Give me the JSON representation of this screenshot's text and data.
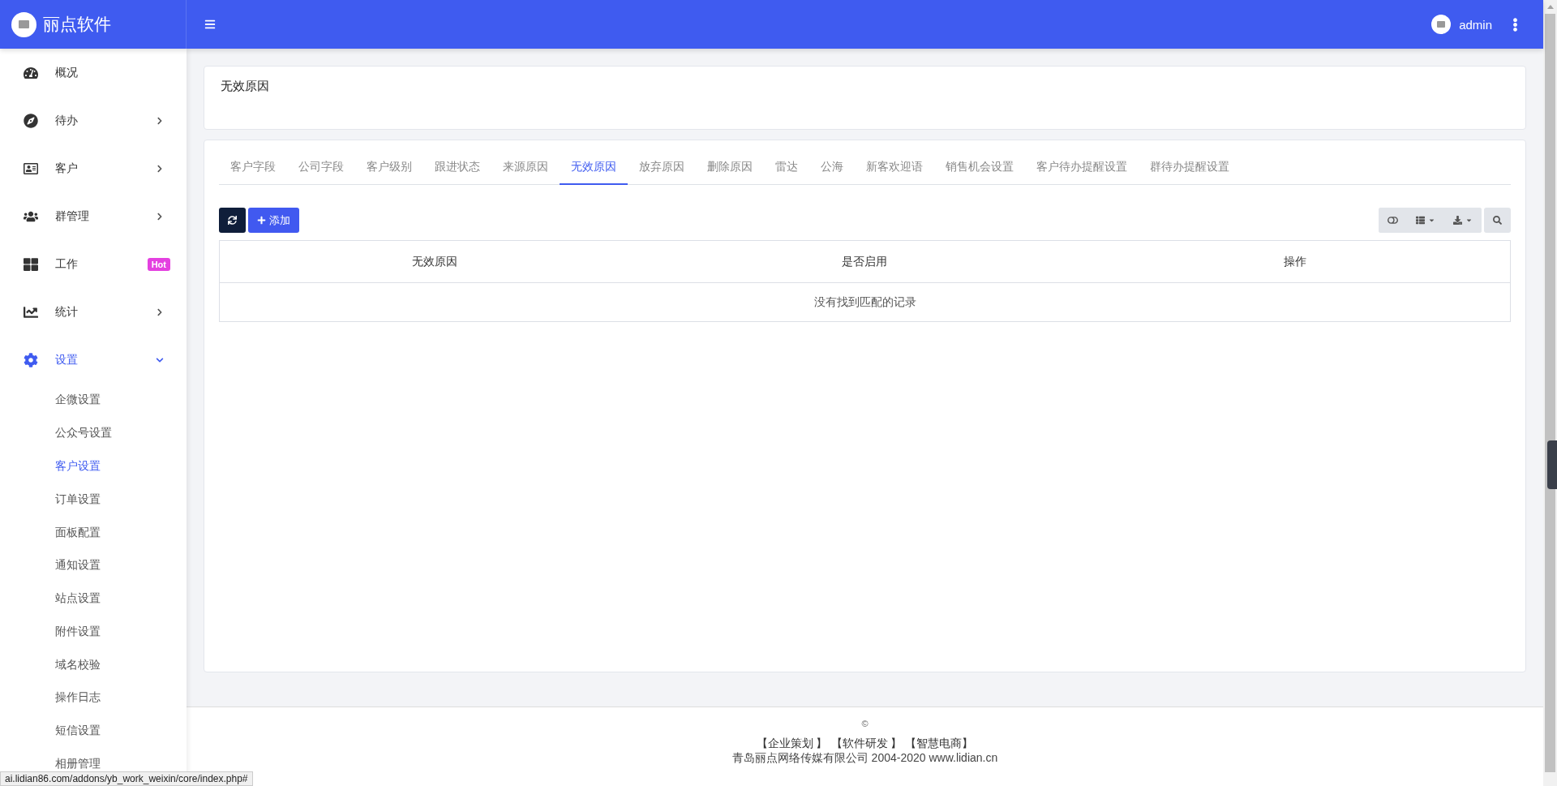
{
  "brand": {
    "name": "丽点软件"
  },
  "header": {
    "user": "admin"
  },
  "sidebar": {
    "items": [
      {
        "label": "概况",
        "kind": "link",
        "selected": false
      },
      {
        "label": "待办",
        "kind": "group",
        "expanded": false,
        "selected": false
      },
      {
        "label": "客户",
        "kind": "group",
        "expanded": false,
        "selected": false
      },
      {
        "label": "群管理",
        "kind": "group",
        "expanded": false,
        "selected": false
      },
      {
        "label": "工作",
        "kind": "link",
        "selected": false,
        "badge": "Hot"
      },
      {
        "label": "统计",
        "kind": "group",
        "expanded": false,
        "selected": false
      },
      {
        "label": "设置",
        "kind": "group",
        "expanded": true,
        "selected": true,
        "children": [
          {
            "label": "企微设置",
            "selected": false
          },
          {
            "label": "公众号设置",
            "selected": false
          },
          {
            "label": "客户设置",
            "selected": true
          },
          {
            "label": "订单设置",
            "selected": false
          },
          {
            "label": "面板配置",
            "selected": false
          },
          {
            "label": "通知设置",
            "selected": false
          },
          {
            "label": "站点设置",
            "selected": false
          },
          {
            "label": "附件设置",
            "selected": false
          },
          {
            "label": "域名校验",
            "selected": false
          },
          {
            "label": "操作日志",
            "selected": false
          },
          {
            "label": "短信设置",
            "selected": false
          },
          {
            "label": "相册管理",
            "selected": false
          }
        ]
      }
    ]
  },
  "page_title": "无效原因",
  "tabs": [
    {
      "label": "客户字段",
      "selected": false
    },
    {
      "label": "公司字段",
      "selected": false
    },
    {
      "label": "客户级别",
      "selected": false
    },
    {
      "label": "跟进状态",
      "selected": false
    },
    {
      "label": "来源原因",
      "selected": false
    },
    {
      "label": "无效原因",
      "selected": true
    },
    {
      "label": "放弃原因",
      "selected": false
    },
    {
      "label": "删除原因",
      "selected": false
    },
    {
      "label": "雷达",
      "selected": false
    },
    {
      "label": "公海",
      "selected": false
    },
    {
      "label": "新客欢迎语",
      "selected": false
    },
    {
      "label": "销售机会设置",
      "selected": false
    },
    {
      "label": "客户待办提醒设置",
      "selected": false
    },
    {
      "label": "群待办提醒设置",
      "selected": false
    }
  ],
  "toolbar": {
    "add_label": "添加"
  },
  "table": {
    "columns": [
      "无效原因",
      "是否启用",
      "操作"
    ],
    "empty_message": "没有找到匹配的记录"
  },
  "footer": {
    "copyright_mark": "©",
    "links": [
      "【企业策划 】",
      "【软件研发 】",
      "【智慧电商】"
    ],
    "company": "青岛丽点网络传媒有限公司 2004-2020 www.lidian.cn"
  },
  "status_url": "ai.lidian86.com/addons/yb_work_weixin/core/index.php#"
}
